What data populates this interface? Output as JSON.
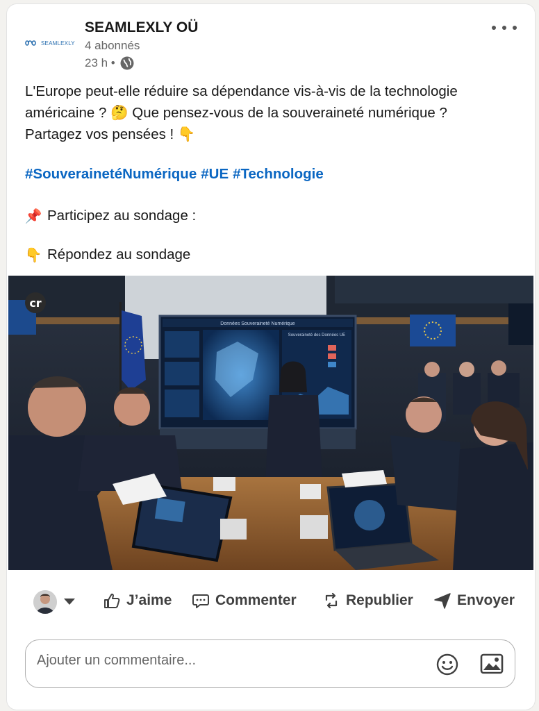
{
  "post": {
    "author": "SEAMLEXLY OÜ",
    "logo_text": "SEAMLEXLY",
    "followers": "4 abonnés",
    "time": "23 h •",
    "text_line1": "L'Europe peut-elle réduire sa dépendance vis-à-vis de la technologie",
    "text_line2": "américaine ? 🤔 Que pensez-vous de la souveraineté numérique ?",
    "text_line3": "Partagez vos pensées ! 👇",
    "hashtags": [
      "#SouverainetéNumérique",
      "#UE",
      "#Technologie"
    ],
    "poll_prompt": "Participez au sondage :",
    "poll_prompt_emoji": "📌",
    "poll_answer": "Répondez au sondage",
    "poll_answer_emoji": "👇",
    "image_badge": "cr",
    "image_screen_title": "Données Souveraineté Numérique",
    "image_screen_panel": "Souveraineté des Données UE"
  },
  "actions": {
    "like": "J’aime",
    "comment": "Commenter",
    "repost": "Republier",
    "send": "Envoyer"
  },
  "comment": {
    "placeholder": "Ajouter un commentaire..."
  },
  "icons": {
    "more": "more-options-icon",
    "visibility": "globe-icon",
    "like": "thumbs-up-icon",
    "comment": "comment-bubble-icon",
    "repost": "repost-arrows-icon",
    "send": "paper-plane-icon",
    "emoji": "smiley-icon",
    "image": "image-icon"
  },
  "colors": {
    "link": "#0a66c2",
    "text": "#191919",
    "muted": "#666666",
    "action": "#404040"
  }
}
